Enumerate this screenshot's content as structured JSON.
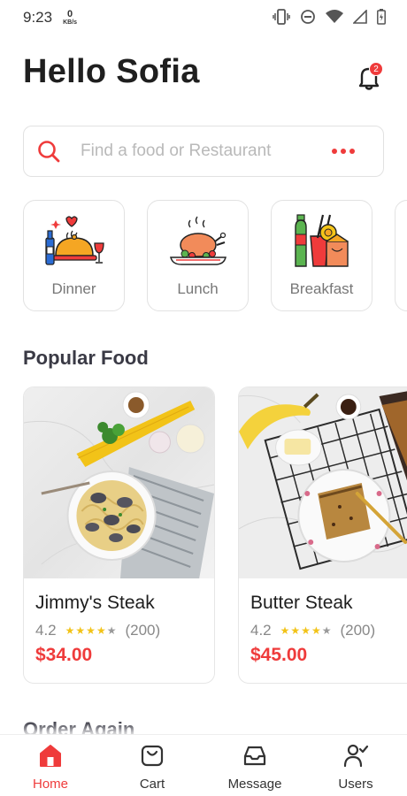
{
  "status_bar": {
    "time": "9:23",
    "net_speed": "0",
    "net_unit": "KB/s"
  },
  "header": {
    "greeting": "Hello Sofia",
    "notification_count": "2"
  },
  "search": {
    "placeholder": "Find a food or Restaurant"
  },
  "categories": [
    {
      "label": "Dinner",
      "icon": "dinner-icon"
    },
    {
      "label": "Lunch",
      "icon": "lunch-icon"
    },
    {
      "label": "Breakfast",
      "icon": "breakfast-icon"
    }
  ],
  "popular": {
    "title": "Popular Food",
    "items": [
      {
        "name": "Jimmy's Steak",
        "rating": "4.2",
        "reviews": "(200)",
        "price": "$34.00",
        "stars": 4
      },
      {
        "name": "Butter Steak",
        "rating": "4.2",
        "reviews": "(200)",
        "price": "$45.00",
        "stars": 4
      }
    ]
  },
  "order_again": {
    "title": "Order Again"
  },
  "nav": [
    {
      "label": "Home",
      "icon": "home-icon",
      "active": true
    },
    {
      "label": "Cart",
      "icon": "cart-icon",
      "active": false
    },
    {
      "label": "Message",
      "icon": "inbox-icon",
      "active": false
    },
    {
      "label": "Users",
      "icon": "user-check-icon",
      "active": false
    }
  ],
  "colors": {
    "accent": "#ef3b3b",
    "star": "#f2c318",
    "text": "#1d1d1d",
    "muted": "#888888"
  }
}
